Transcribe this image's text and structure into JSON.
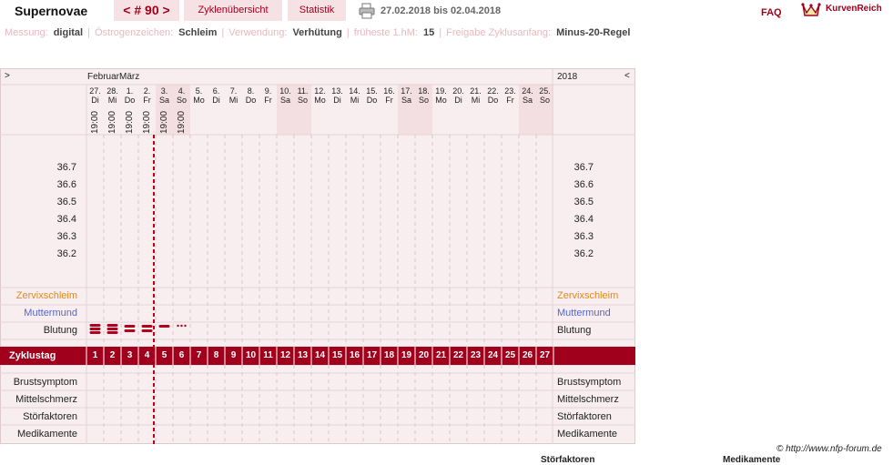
{
  "header": {
    "brand": "Supernovae",
    "cycle_nav": "< # 90 >",
    "tab_overview": "Zyklenübersicht",
    "tab_statistics": "Statistik",
    "date_range": "27.02.2018 bis 02.04.2018",
    "faq": "FAQ",
    "logo_text": "KurvenReich",
    "icons": [
      "printer-icon",
      "crown-logo-icon"
    ],
    "colors": {
      "accent": "#a0001c",
      "tab_bg": "#f6e2e4"
    }
  },
  "settings": [
    {
      "label": "Messung:",
      "value": "digital"
    },
    {
      "label": "Östrogenzeichen:",
      "value": "Schleim"
    },
    {
      "label": "Verwendung:",
      "value": "Verhütung"
    },
    {
      "label": "früheste 1.hM:",
      "value": "15"
    },
    {
      "label": "Freigabe Zyklusanfang:",
      "value": "Minus-20-Regel"
    }
  ],
  "chart": {
    "nav_left": ">",
    "nav_right": "<",
    "month_label": "FebruarMärz",
    "year_label": "2018",
    "days": [
      {
        "d": "27.",
        "w": "Di",
        "t": "19:00",
        "we": false
      },
      {
        "d": "28.",
        "w": "Mi",
        "t": "19:00",
        "we": false
      },
      {
        "d": "1.",
        "w": "Do",
        "t": "19:00",
        "we": false
      },
      {
        "d": "2.",
        "w": "Fr",
        "t": "19:00",
        "we": false
      },
      {
        "d": "3.",
        "w": "Sa",
        "t": "19:00",
        "we": true
      },
      {
        "d": "4.",
        "w": "So",
        "t": "19:00",
        "we": true
      },
      {
        "d": "5.",
        "w": "Mo",
        "t": "",
        "we": false
      },
      {
        "d": "6.",
        "w": "Di",
        "t": "",
        "we": false
      },
      {
        "d": "7.",
        "w": "Mi",
        "t": "",
        "we": false
      },
      {
        "d": "8.",
        "w": "Do",
        "t": "",
        "we": false
      },
      {
        "d": "9.",
        "w": "Fr",
        "t": "",
        "we": false
      },
      {
        "d": "10.",
        "w": "Sa",
        "t": "",
        "we": true
      },
      {
        "d": "11.",
        "w": "So",
        "t": "",
        "we": true
      },
      {
        "d": "12.",
        "w": "Mo",
        "t": "",
        "we": false
      },
      {
        "d": "13.",
        "w": "Di",
        "t": "",
        "we": false
      },
      {
        "d": "14.",
        "w": "Mi",
        "t": "",
        "we": false
      },
      {
        "d": "15.",
        "w": "Do",
        "t": "",
        "we": false
      },
      {
        "d": "16.",
        "w": "Fr",
        "t": "",
        "we": false
      },
      {
        "d": "17.",
        "w": "Sa",
        "t": "",
        "we": true
      },
      {
        "d": "18.",
        "w": "So",
        "t": "",
        "we": true
      },
      {
        "d": "19.",
        "w": "Mo",
        "t": "",
        "we": false
      },
      {
        "d": "20.",
        "w": "Di",
        "t": "",
        "we": false
      },
      {
        "d": "21.",
        "w": "Mi",
        "t": "",
        "we": false
      },
      {
        "d": "22.",
        "w": "Do",
        "t": "",
        "we": false
      },
      {
        "d": "23.",
        "w": "Fr",
        "t": "",
        "we": false
      },
      {
        "d": "24.",
        "w": "Sa",
        "t": "",
        "we": true
      },
      {
        "d": "25.",
        "w": "So",
        "t": "",
        "we": true
      }
    ],
    "temp_labels": [
      "36.7",
      "36.6",
      "36.5",
      "36.4",
      "36.3",
      "36.2"
    ],
    "rows": {
      "mucus": "Zervixschleim",
      "cervix": "Muttermund",
      "bleeding": "Blutung",
      "cycle_day": "Zyklustag",
      "breast": "Brustsymptom",
      "midpain": "Mittelschmerz",
      "disturb": "Störfaktoren",
      "meds": "Medikamente"
    },
    "cycle_days": [
      "1",
      "2",
      "3",
      "4",
      "5",
      "6",
      "7",
      "8",
      "9",
      "10",
      "11",
      "12",
      "13",
      "14",
      "15",
      "16",
      "17",
      "18",
      "19",
      "20",
      "21",
      "22",
      "23",
      "24",
      "25",
      "26",
      "27"
    ],
    "bleeding_levels": [
      3,
      3,
      2,
      2,
      1,
      0.5
    ],
    "today_marker_day_index": 4,
    "colors": {
      "mucus_label": "#e08a1e",
      "cervix_label": "#5566cc",
      "bleeding": "#b0001e",
      "cycle_bar": "#a0001c",
      "weekend": "#f3dfe1",
      "panel": "#f8eef0",
      "today_line": "#c00018"
    }
  },
  "footer": {
    "copyright": "© http://www.nfp-forum.de",
    "cut_off_1": "Störfaktoren",
    "cut_off_2": "Medikamente"
  }
}
